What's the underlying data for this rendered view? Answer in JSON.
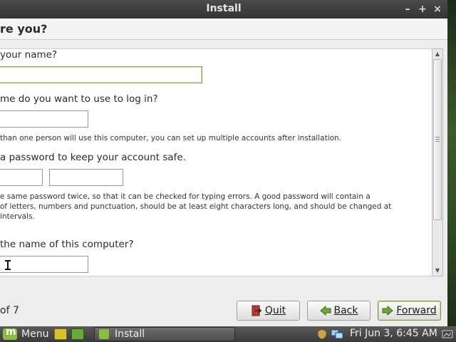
{
  "window": {
    "title": "Install",
    "minimize_glyph": "–",
    "maximize_glyph": "+",
    "close_glyph": "×"
  },
  "page": {
    "heading": "re you?"
  },
  "form": {
    "name_question": "your name?",
    "login_question": "me do you want to use to log in?",
    "login_hint": "than one person will use this computer, you can set up multiple accounts after installation.",
    "password_question": "a password to keep your account safe.",
    "password_hint_1": "e same password twice, so that it can be checked for typing errors. A good password will contain a",
    "password_hint_2": " of letters, numbers and punctuation, should be at least eight characters long, and should be changed at",
    "password_hint_3": " intervals.",
    "computer_question": "the name of this computer?",
    "name_value": "",
    "login_value": "",
    "password_value": "",
    "password_confirm_value": "",
    "computer_value": ""
  },
  "footer": {
    "step": "of 7",
    "quit_label": "Quit",
    "back_label": "Back",
    "forward_label": "Forward"
  },
  "taskbar": {
    "menu_label": "Menu",
    "task_label": "Install",
    "clock": "Fri Jun  3,  6:45 AM"
  },
  "colors": {
    "accent_green": "#8bbd3c",
    "focus_border": "#8aa84a"
  }
}
